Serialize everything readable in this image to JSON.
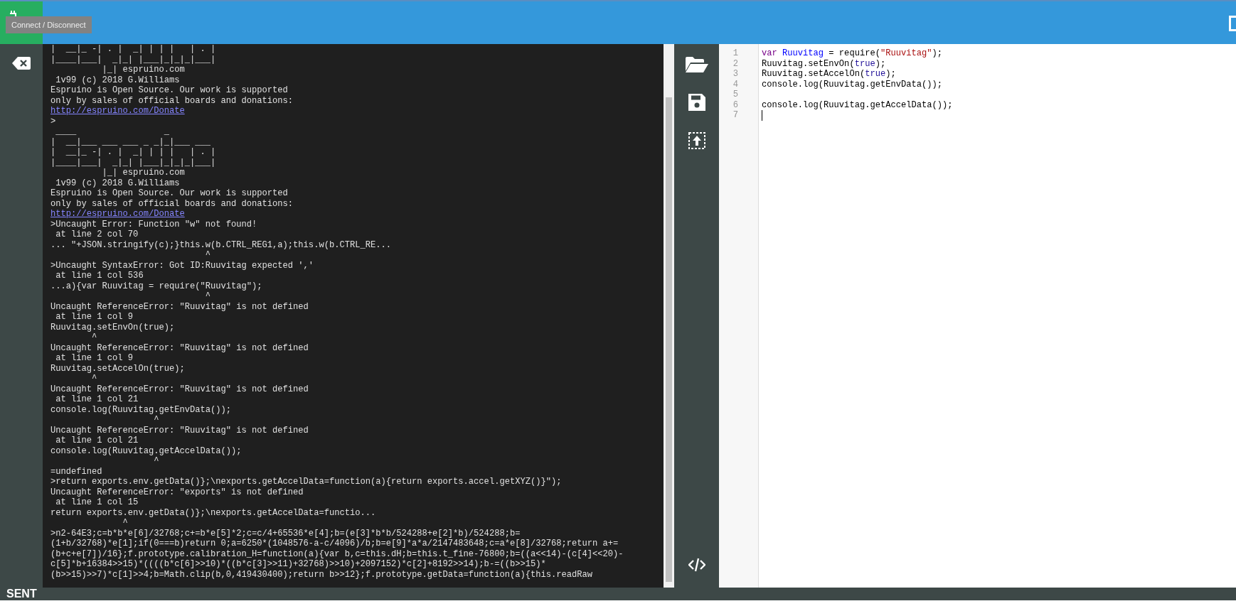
{
  "toolbar": {
    "tooltip": "Connect / Disconnect"
  },
  "terminal": {
    "lines": [
      {
        "kind": "text",
        "text": "|  __|_ -| . |  _| | | |   | . |"
      },
      {
        "kind": "text",
        "text": "|____|___|  _|_| |___|_|_|_|___|"
      },
      {
        "kind": "text",
        "text": "          |_| espruino.com"
      },
      {
        "kind": "text",
        "text": " 1v99 (c) 2018 G.Williams"
      },
      {
        "kind": "text",
        "text": "Espruino is Open Source. Our work is supported"
      },
      {
        "kind": "text",
        "text": "only by sales of official boards and donations:"
      },
      {
        "kind": "link",
        "text": "http://espruino.com/Donate"
      },
      {
        "kind": "text",
        "text": ">"
      },
      {
        "kind": "text",
        "text": " ____                 _"
      },
      {
        "kind": "text",
        "text": "|  __|___ ___ ___ _ _|_|___ ___"
      },
      {
        "kind": "text",
        "text": "|  __|_ -| . |  _| | | |   | . |"
      },
      {
        "kind": "text",
        "text": "|____|___|  _|_| |___|_|_|_|___|"
      },
      {
        "kind": "text",
        "text": "          |_| espruino.com"
      },
      {
        "kind": "text",
        "text": " 1v99 (c) 2018 G.Williams"
      },
      {
        "kind": "text",
        "text": "Espruino is Open Source. Our work is supported"
      },
      {
        "kind": "text",
        "text": "only by sales of official boards and donations:"
      },
      {
        "kind": "link",
        "text": "http://espruino.com/Donate"
      },
      {
        "kind": "text",
        "text": ">Uncaught Error: Function \"w\" not found!"
      },
      {
        "kind": "text",
        "text": " at line 2 col 70"
      },
      {
        "kind": "text",
        "text": "... \"+JSON.stringify(c);}this.w(b.CTRL_REG1,a);this.w(b.CTRL_RE..."
      },
      {
        "kind": "text",
        "text": "                              ^"
      },
      {
        "kind": "text",
        "text": ">Uncaught SyntaxError: Got ID:Ruuvitag expected ','"
      },
      {
        "kind": "text",
        "text": " at line 1 col 536"
      },
      {
        "kind": "text",
        "text": "...a){var Ruuvitag = require(\"Ruuvitag\");"
      },
      {
        "kind": "text",
        "text": "                              ^"
      },
      {
        "kind": "text",
        "text": "Uncaught ReferenceError: \"Ruuvitag\" is not defined"
      },
      {
        "kind": "text",
        "text": " at line 1 col 9"
      },
      {
        "kind": "text",
        "text": "Ruuvitag.setEnvOn(true);"
      },
      {
        "kind": "text",
        "text": "        ^"
      },
      {
        "kind": "text",
        "text": "Uncaught ReferenceError: \"Ruuvitag\" is not defined"
      },
      {
        "kind": "text",
        "text": " at line 1 col 9"
      },
      {
        "kind": "text",
        "text": "Ruuvitag.setAccelOn(true);"
      },
      {
        "kind": "text",
        "text": "        ^"
      },
      {
        "kind": "text",
        "text": "Uncaught ReferenceError: \"Ruuvitag\" is not defined"
      },
      {
        "kind": "text",
        "text": " at line 1 col 21"
      },
      {
        "kind": "text",
        "text": "console.log(Ruuvitag.getEnvData());"
      },
      {
        "kind": "text",
        "text": "                    ^"
      },
      {
        "kind": "text",
        "text": "Uncaught ReferenceError: \"Ruuvitag\" is not defined"
      },
      {
        "kind": "text",
        "text": " at line 1 col 21"
      },
      {
        "kind": "text",
        "text": "console.log(Ruuvitag.getAccelData());"
      },
      {
        "kind": "text",
        "text": "                    ^"
      },
      {
        "kind": "text",
        "text": "=undefined"
      },
      {
        "kind": "text",
        "text": ">return exports.env.getData()};\\nexports.getAccelData=function(a){return exports.accel.getXYZ()}\");"
      },
      {
        "kind": "text",
        "text": "Uncaught ReferenceError: \"exports\" is not defined"
      },
      {
        "kind": "text",
        "text": " at line 1 col 15"
      },
      {
        "kind": "text",
        "text": "return exports.env.getData()};\\nexports.getAccelData=functio..."
      },
      {
        "kind": "text",
        "text": "              ^"
      },
      {
        "kind": "text",
        "text": ">n2-64E3;c=b*b*e[6]/32768;c+=b*e[5]*2;c=c/4+65536*e[4];b=(e[3]*b*b/524288+e[2]*b)/524288;b="
      },
      {
        "kind": "text",
        "text": "(1+b/32768)*e[1];if(0===b)return 0;a=6250*(1048576-a-c/4096)/b;b=e[9]*a*a/2147483648;c=a*e[8]/32768;return a+="
      },
      {
        "kind": "text",
        "text": "(b+c+e[7])/16};f.prototype.calibration_H=function(a){var b,c=this.dH;b=this.t_fine-76800;b=((a<<14)-(c[4]<<20)-"
      },
      {
        "kind": "text",
        "text": "c[5]*b+16384>>15)*((((b*c[6]>>10)*((b*c[3]>>11)+32768)>>10)+2097152)*c[2]+8192>>14);b-=((b>>15)*"
      },
      {
        "kind": "text",
        "text": "(b>>15)>>7)*c[1]>>4;b=Math.clip(b,0,419430400);return b>>12};f.prototype.getData=function(a){this.readRaw"
      }
    ]
  },
  "editor": {
    "lines": [
      {
        "number": "1",
        "cursor": false,
        "tokens": [
          {
            "kind": "keyword",
            "text": "var "
          },
          {
            "kind": "variable",
            "text": "Ruuvitag"
          },
          {
            "kind": "plain",
            "text": " = require("
          },
          {
            "kind": "string",
            "text": "\"Ruuvitag\""
          },
          {
            "kind": "plain",
            "text": ");"
          }
        ]
      },
      {
        "number": "2",
        "cursor": false,
        "tokens": [
          {
            "kind": "plain",
            "text": "Ruuvitag.setEnvOn("
          },
          {
            "kind": "atom",
            "text": "true"
          },
          {
            "kind": "plain",
            "text": ");"
          }
        ]
      },
      {
        "number": "3",
        "cursor": false,
        "tokens": [
          {
            "kind": "plain",
            "text": "Ruuvitag.setAccelOn("
          },
          {
            "kind": "atom",
            "text": "true"
          },
          {
            "kind": "plain",
            "text": ");"
          }
        ]
      },
      {
        "number": "4",
        "cursor": false,
        "tokens": [
          {
            "kind": "plain",
            "text": "console.log(Ruuvitag.getEnvData());"
          }
        ]
      },
      {
        "number": "5",
        "cursor": false
      },
      {
        "number": "6",
        "cursor": false,
        "tokens": [
          {
            "kind": "plain",
            "text": "console.log(Ruuvitag.getAccelData());"
          }
        ]
      },
      {
        "number": "7",
        "cursor": true
      }
    ]
  },
  "status_bar": {
    "text": "SENT"
  }
}
